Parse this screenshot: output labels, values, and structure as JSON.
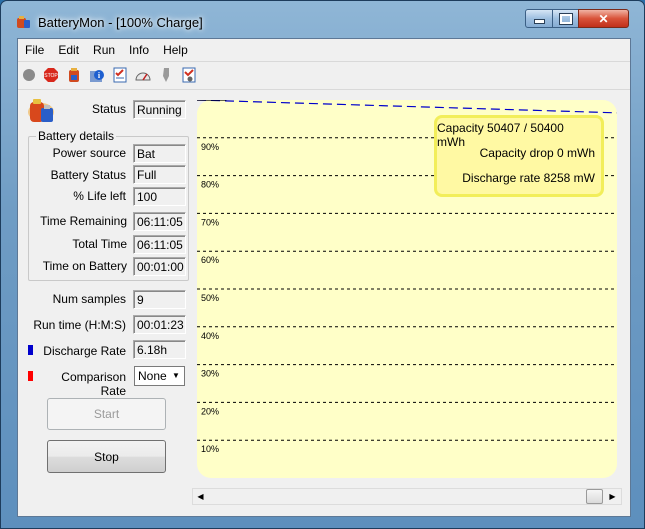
{
  "window": {
    "title": "BatteryMon - [100% Charge]"
  },
  "menu": [
    "File",
    "Edit",
    "Run",
    "Info",
    "Help"
  ],
  "toolbar_icons": [
    "record-icon",
    "stop-icon",
    "battery-icon",
    "info-icon",
    "checklist-icon",
    "gauge-icon",
    "tool-icon",
    "settings-icon"
  ],
  "status": {
    "label": "Status",
    "value": "Running"
  },
  "battery_details": {
    "title": "Battery details",
    "power_source": {
      "label": "Power source",
      "value": "Bat"
    },
    "battery_status": {
      "label": "Battery Status",
      "value": "Full"
    },
    "life_left": {
      "label": "% Life left",
      "value": "100"
    },
    "time_remaining": {
      "label": "Time Remaining",
      "value": "06:11:05"
    },
    "total_time": {
      "label": "Total Time",
      "value": "06:11:05"
    },
    "time_on_battery": {
      "label": "Time on Battery",
      "value": "00:01:00"
    }
  },
  "num_samples": {
    "label": "Num samples",
    "value": "9"
  },
  "run_time": {
    "label": "Run time (H:M:S)",
    "value": "00:01:23"
  },
  "discharge_rate": {
    "label": "Discharge Rate",
    "value": "6.18h",
    "color": "#0000cc"
  },
  "comparison_rate": {
    "label": "Comparison Rate",
    "value": "None",
    "color": "#ff0000"
  },
  "buttons": {
    "start": "Start",
    "stop": "Stop"
  },
  "chart_data": {
    "type": "line",
    "y_tick_labels": [
      "90%",
      "80%",
      "70%",
      "60%",
      "50%",
      "40%",
      "30%",
      "20%",
      "10%"
    ],
    "ylim": [
      0,
      100
    ],
    "grid": true,
    "background": "#ffffc8",
    "series": [
      {
        "color": "#0000cc",
        "style": "dashed",
        "x": [
          0,
          1
        ],
        "y": [
          100,
          96.6
        ]
      },
      {
        "color": "#000000",
        "style": "solid",
        "x": [
          0,
          0.07
        ],
        "y": [
          100,
          100
        ]
      }
    ],
    "annotations": [
      "Capacity 50407 / 50400 mWh",
      "Capacity drop 0 mWh",
      "Discharge rate 8258 mW"
    ]
  }
}
